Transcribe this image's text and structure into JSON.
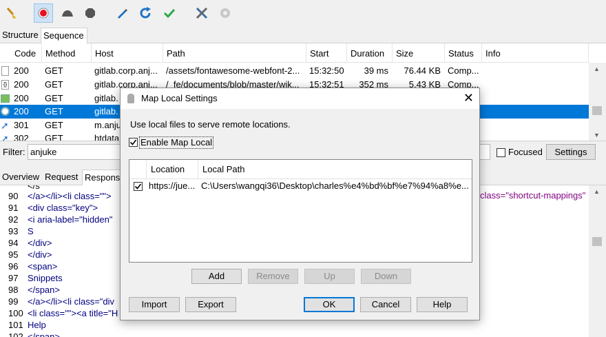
{
  "toolbar": {
    "icons": [
      "broom-icon",
      "record-icon",
      "throttle-icon",
      "stop-icon",
      "pen-icon",
      "refresh-icon",
      "check-icon",
      "tools-icon",
      "gear-icon"
    ]
  },
  "top_tabs": [
    "Structure",
    "Sequence"
  ],
  "table": {
    "columns": [
      "Code",
      "Method",
      "Host",
      "Path",
      "Start",
      "Duration",
      "Size",
      "Status",
      "Info"
    ],
    "rows": [
      {
        "code": "200",
        "method": "GET",
        "host": "gitlab.corp.anj...",
        "path": "/assets/fontawesome-webfont-2...",
        "start": "15:32:50",
        "duration": "39 ms",
        "size": "76.44 KB",
        "status": "Comp..."
      },
      {
        "code": "200",
        "method": "GET",
        "host": "gitlab.corp.anj...",
        "path": "/_fe/documents/blob/master/wik...",
        "start": "15:32:51",
        "duration": "352 ms",
        "size": "5.43 KB",
        "status": "Comp..."
      },
      {
        "code": "200",
        "method": "GET",
        "host": "gitlab.",
        "path": "",
        "start": "",
        "duration": "",
        "size": "",
        "status": ""
      },
      {
        "code": "200",
        "method": "GET",
        "host": "gitlab.",
        "path": "",
        "start": "",
        "duration": "",
        "size": "",
        "status": ""
      },
      {
        "code": "301",
        "method": "GET",
        "host": "m.anju",
        "path": "",
        "start": "",
        "duration": "",
        "size": "",
        "status": ""
      },
      {
        "code": "302",
        "method": "GET",
        "host": "htdata",
        "path": "",
        "start": "",
        "duration": "",
        "size": "",
        "status": ""
      }
    ]
  },
  "filter": {
    "label": "Filter:",
    "value": "anjuke",
    "focused_label": "Focused",
    "settings_label": "Settings"
  },
  "bottom_tabs": [
    "Overview",
    "Request",
    "Respons"
  ],
  "code_lines": [
    {
      "n": "90",
      "text": "</a></li><li class=\"\">"
    },
    {
      "n": "91",
      "text": "<div class=\"key\">"
    },
    {
      "n": "92",
      "text": "<i aria-label=\"hidden\""
    },
    {
      "n": "93",
      "text": "S"
    },
    {
      "n": "94",
      "text": "</div>"
    },
    {
      "n": "95",
      "text": "</div>"
    },
    {
      "n": "96",
      "text": "<span>"
    },
    {
      "n": "97",
      "text": "Snippets"
    },
    {
      "n": "98",
      "text": "</span>"
    },
    {
      "n": "99",
      "text": "</a></li><li class=\"div"
    },
    {
      "n": "100",
      "text": "<li class=\"\"><a title=\"H"
    },
    {
      "n": "101",
      "text": "Help"
    },
    {
      "n": "102",
      "text": "</span>"
    }
  ],
  "code_right_fragment": "class=\"shortcut-mappings\"",
  "dialog": {
    "title": "Map Local Settings",
    "description": "Use local files to serve remote locations.",
    "enable_label": "Enable Map Local",
    "columns": [
      "Location",
      "Local Path"
    ],
    "rows": [
      {
        "location": "https://jue...",
        "local_path": "C:\\Users\\wangqi36\\Desktop\\charles%e4%bd%bf%e7%94%a8%e..."
      }
    ],
    "buttons": {
      "add": "Add",
      "remove": "Remove",
      "up": "Up",
      "down": "Down",
      "import": "Import",
      "export": "Export",
      "ok": "OK",
      "cancel": "Cancel",
      "help": "Help"
    }
  }
}
